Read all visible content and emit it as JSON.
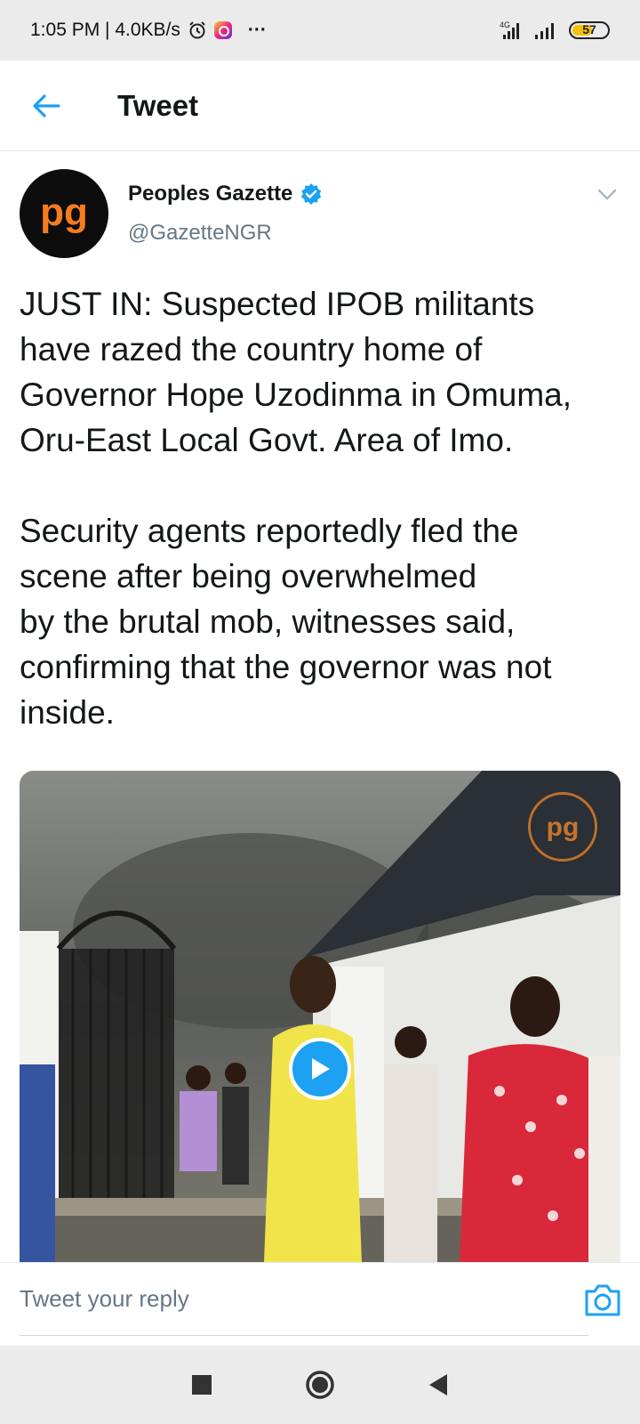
{
  "status_bar": {
    "time_speed": "1:05 PM | 4.0KB/s",
    "network_label": "4G",
    "battery_level": "57",
    "battery_fraction": 0.57,
    "more": "···"
  },
  "header": {
    "title": "Tweet"
  },
  "tweet": {
    "author_name": "Peoples Gazette",
    "author_handle": "@GazetteNGR",
    "verified": true,
    "avatar_text": "pg",
    "paragraphs": [
      "JUST IN: Suspected IPOB militants\nhave razed the country home of\nGovernor Hope Uzodinma in Omuma,\nOru-East Local Govt. Area of Imo.",
      "Security agents reportedly fled the\nscene after being overwhelmed\nby the brutal mob, witnesses said,\nconfirming that the governor was not\ninside."
    ],
    "media_watermark": "pg"
  },
  "reply": {
    "placeholder": "Tweet your reply"
  },
  "colors": {
    "accent": "#1da1f2",
    "brand_orange": "#f57c1f",
    "text_primary": "#14171a",
    "text_secondary": "#657786"
  }
}
